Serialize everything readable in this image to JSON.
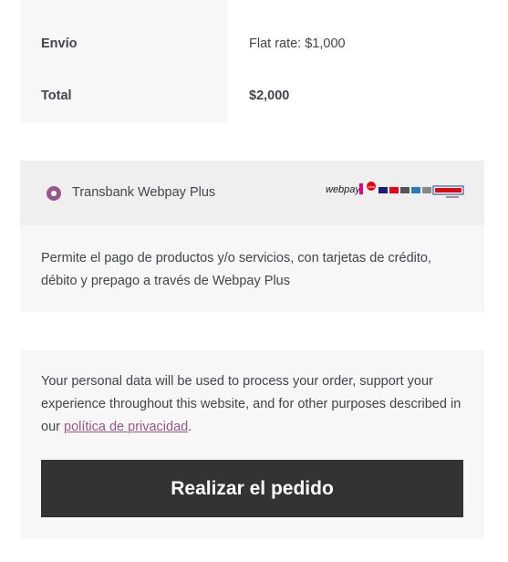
{
  "order_totals": {
    "shipping_label": "Envío",
    "shipping_value": "Flat rate: $1,000",
    "total_label": "Total",
    "total_value": "$2,000"
  },
  "payment": {
    "method_label": "Transbank Webpay Plus",
    "logo_name": "webpay-logo",
    "logo_text": "webpay",
    "logo_badge": "plus",
    "description": "Permite el pago de productos y/o servicios, con tarjetas de crédito, débito y prepago a través de Webpay Plus",
    "selected": true,
    "accent_color": "#96588a"
  },
  "privacy": {
    "text_before": "Your personal data will be used to process your order, support your experience throughout this website, and for other purposes described in our ",
    "link_text": "política de privacidad",
    "text_after": "."
  },
  "place_order": {
    "label": "Realizar el pedido"
  }
}
